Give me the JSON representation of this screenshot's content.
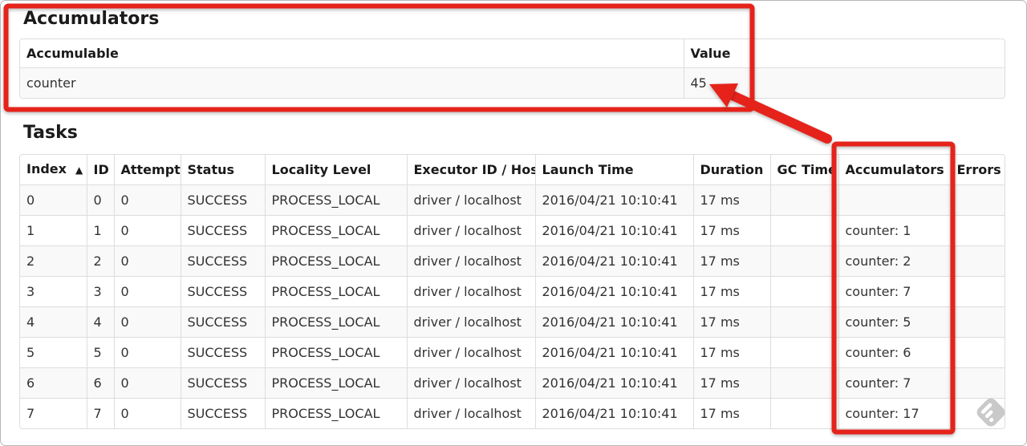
{
  "colors": {
    "annotation_red": "#e5231b",
    "table_border": "#dddddd",
    "row_stripe": "#f9f9f9",
    "watermark_gray": "#c7c7c7"
  },
  "accumulators_section": {
    "heading": "Accumulators",
    "table": {
      "headers": [
        "Accumulable",
        "Value"
      ],
      "rows": [
        {
          "accumulable": "counter",
          "value": "45"
        }
      ]
    }
  },
  "tasks_section": {
    "heading": "Tasks",
    "table": {
      "headers": [
        "Index",
        "ID",
        "Attempt",
        "Status",
        "Locality Level",
        "Executor ID / Host",
        "Launch Time",
        "Duration",
        "GC Time",
        "Accumulators",
        "Errors"
      ],
      "sort_indicator": "▲",
      "rows": [
        {
          "index": "0",
          "id": "0",
          "attempt": "0",
          "status": "SUCCESS",
          "locality_level": "PROCESS_LOCAL",
          "executor_id_host": "driver / localhost",
          "launch_time": "2016/04/21 10:10:41",
          "duration": "17 ms",
          "gc_time": "",
          "accumulators": "",
          "errors": ""
        },
        {
          "index": "1",
          "id": "1",
          "attempt": "0",
          "status": "SUCCESS",
          "locality_level": "PROCESS_LOCAL",
          "executor_id_host": "driver / localhost",
          "launch_time": "2016/04/21 10:10:41",
          "duration": "17 ms",
          "gc_time": "",
          "accumulators": "counter: 1",
          "errors": ""
        },
        {
          "index": "2",
          "id": "2",
          "attempt": "0",
          "status": "SUCCESS",
          "locality_level": "PROCESS_LOCAL",
          "executor_id_host": "driver / localhost",
          "launch_time": "2016/04/21 10:10:41",
          "duration": "17 ms",
          "gc_time": "",
          "accumulators": "counter: 2",
          "errors": ""
        },
        {
          "index": "3",
          "id": "3",
          "attempt": "0",
          "status": "SUCCESS",
          "locality_level": "PROCESS_LOCAL",
          "executor_id_host": "driver / localhost",
          "launch_time": "2016/04/21 10:10:41",
          "duration": "17 ms",
          "gc_time": "",
          "accumulators": "counter: 7",
          "errors": ""
        },
        {
          "index": "4",
          "id": "4",
          "attempt": "0",
          "status": "SUCCESS",
          "locality_level": "PROCESS_LOCAL",
          "executor_id_host": "driver / localhost",
          "launch_time": "2016/04/21 10:10:41",
          "duration": "17 ms",
          "gc_time": "",
          "accumulators": "counter: 5",
          "errors": ""
        },
        {
          "index": "5",
          "id": "5",
          "attempt": "0",
          "status": "SUCCESS",
          "locality_level": "PROCESS_LOCAL",
          "executor_id_host": "driver / localhost",
          "launch_time": "2016/04/21 10:10:41",
          "duration": "17 ms",
          "gc_time": "",
          "accumulators": "counter: 6",
          "errors": ""
        },
        {
          "index": "6",
          "id": "6",
          "attempt": "0",
          "status": "SUCCESS",
          "locality_level": "PROCESS_LOCAL",
          "executor_id_host": "driver / localhost",
          "launch_time": "2016/04/21 10:10:41",
          "duration": "17 ms",
          "gc_time": "",
          "accumulators": "counter: 7",
          "errors": ""
        },
        {
          "index": "7",
          "id": "7",
          "attempt": "0",
          "status": "SUCCESS",
          "locality_level": "PROCESS_LOCAL",
          "executor_id_host": "driver / localhost",
          "launch_time": "2016/04/21 10:10:41",
          "duration": "17 ms",
          "gc_time": "",
          "accumulators": "counter: 17",
          "errors": ""
        }
      ]
    }
  }
}
